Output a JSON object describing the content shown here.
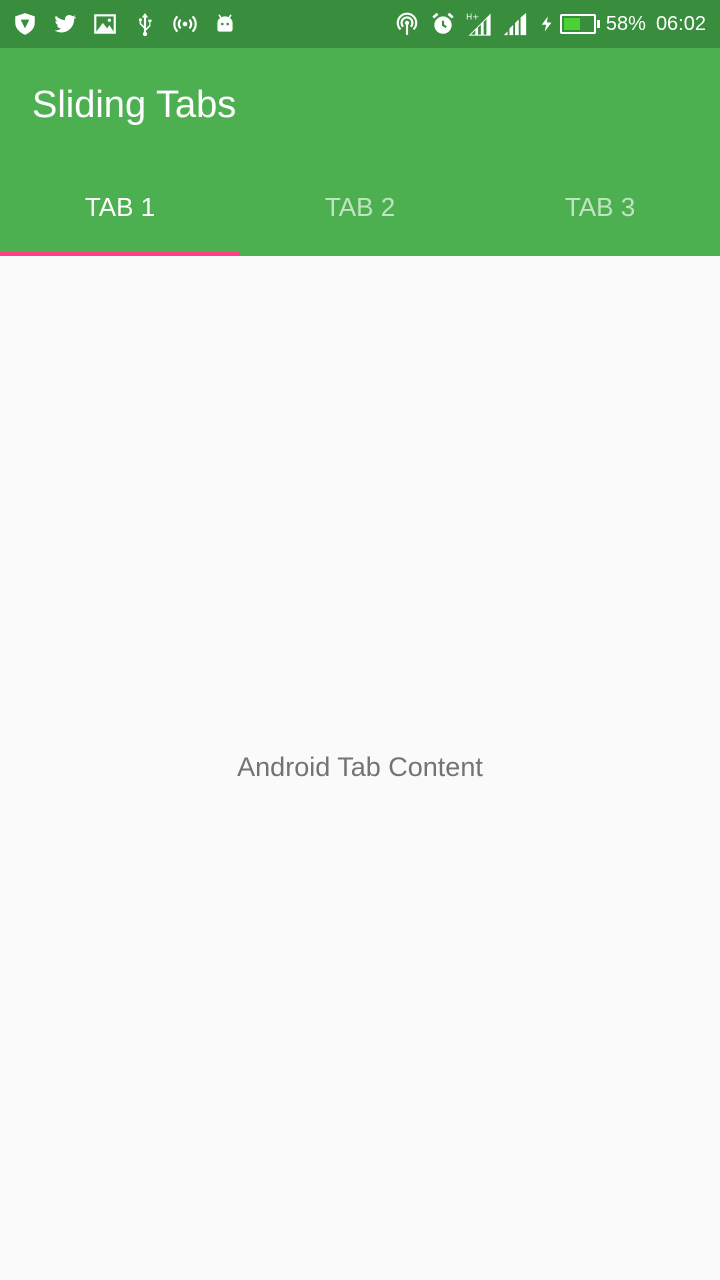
{
  "status_bar": {
    "left_icons": [
      "shield-icon",
      "twitter-icon",
      "image-icon",
      "usb-icon",
      "hotspot-icon",
      "android-icon"
    ],
    "right_icons": [
      "nfc-icon",
      "alarm-icon",
      "signal-ht-icon",
      "signal-icon",
      "charging-icon"
    ],
    "battery_percent": "58%",
    "battery_level": 0.58,
    "time": "06:02"
  },
  "app_bar": {
    "title": "Sliding Tabs",
    "background": "#4caf50"
  },
  "tabs": [
    {
      "label": "TAB 1",
      "active": true
    },
    {
      "label": "TAB 2",
      "active": false
    },
    {
      "label": "TAB 3",
      "active": false
    }
  ],
  "indicator_color": "#ff4081",
  "content": {
    "text": "Android Tab Content"
  }
}
